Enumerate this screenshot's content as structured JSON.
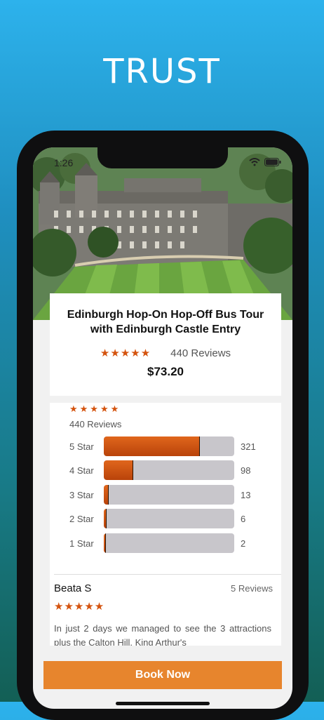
{
  "headline": "TRUST",
  "status_bar": {
    "time": "1:26"
  },
  "tour": {
    "title": "Edinburgh Hop-On Hop-Off Bus Tour with Edinburgh Castle Entry",
    "stars": "★★★★★",
    "reviews_label": "440 Reviews",
    "price": "$73.20"
  },
  "rating_summary": {
    "stars": "★★★★★",
    "reviews_label": "440 Reviews",
    "total": 440,
    "bars": [
      {
        "label": "5 Star",
        "count": "321",
        "fraction": 0.73
      },
      {
        "label": "4 Star",
        "count": "98",
        "fraction": 0.223
      },
      {
        "label": "3 Star",
        "count": "13",
        "fraction": 0.03
      },
      {
        "label": "2 Star",
        "count": "6",
        "fraction": 0.014
      },
      {
        "label": "1 Star",
        "count": "2",
        "fraction": 0.005
      }
    ]
  },
  "review": {
    "author": "Beata S",
    "author_reviews": "5 Reviews",
    "stars": "★★★★★",
    "text": "In just 2 days we managed to see the 3 attractions plus the Calton Hill, King Arthur's"
  },
  "book_button": {
    "label": "Book Now"
  },
  "colors": {
    "accent": "#d4530e",
    "button": "#e7852d",
    "background_top": "#2db2ec",
    "background_bottom": "#135f55"
  }
}
